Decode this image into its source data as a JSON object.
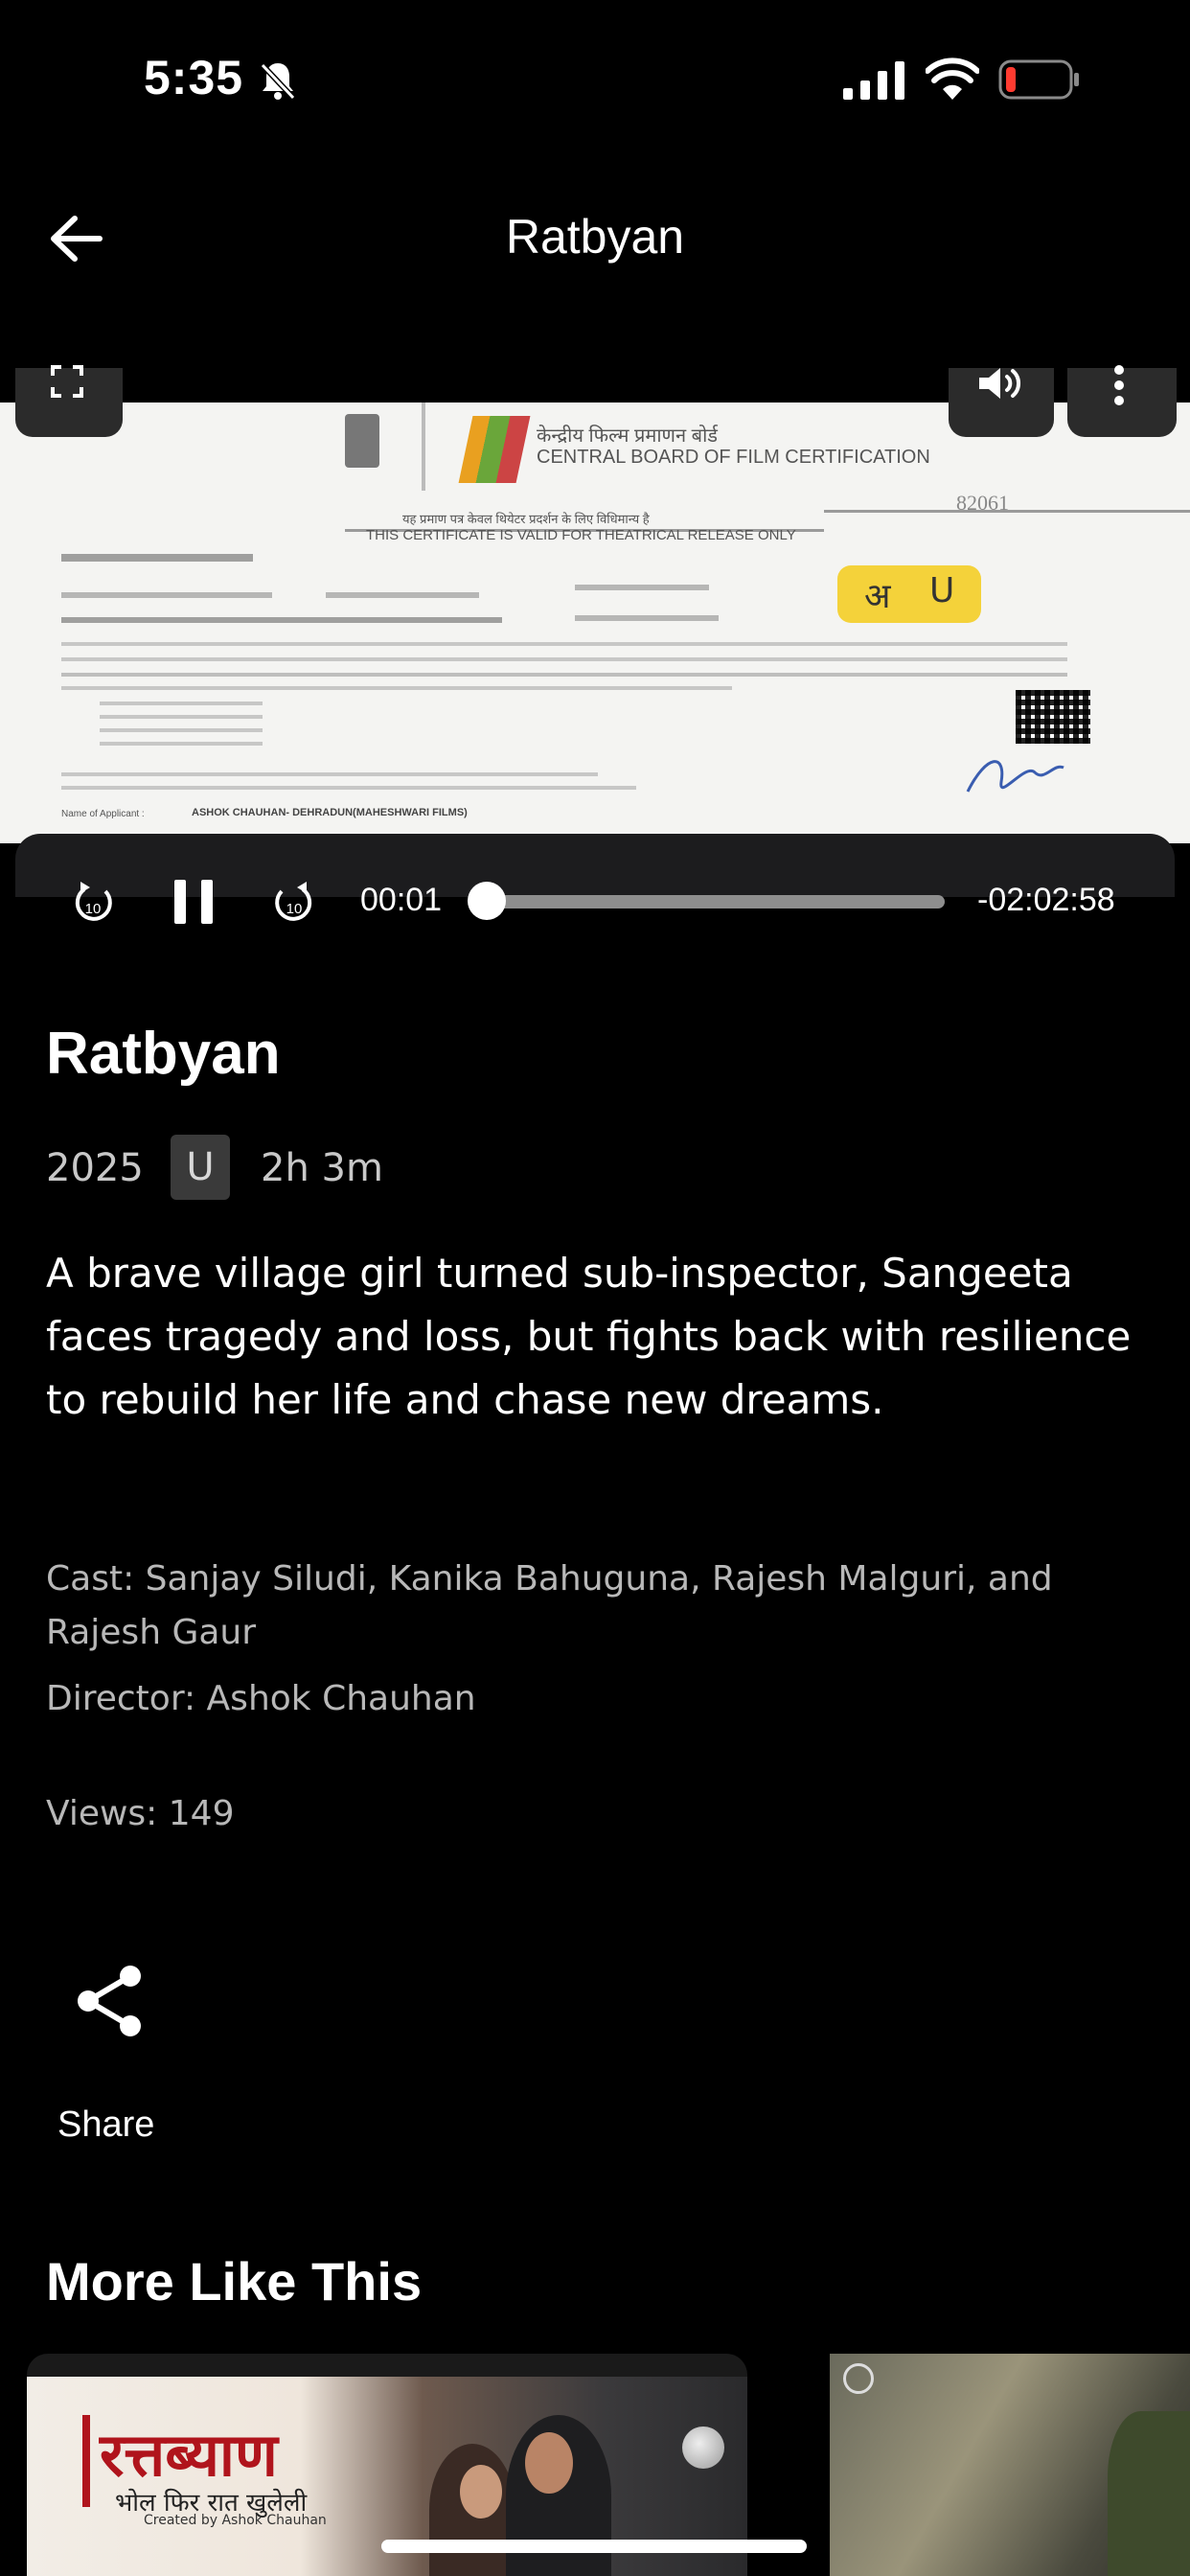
{
  "status_bar": {
    "time": "5:35",
    "battery_color": "#ff3b30"
  },
  "header": {
    "title": "Ratbyan",
    "back_icon": "arrow-left-icon"
  },
  "player": {
    "current_time": "00:01",
    "remaining_time": "-02:02:58",
    "progress": 0.0001,
    "rewind_seconds": "10",
    "forward_seconds": "10",
    "state": "playing",
    "certificate": {
      "hindi_board": "केन्द्रीय फिल्म प्रमाणन बोर्ड",
      "board": "CENTRAL BOARD OF FILM CERTIFICATION",
      "number": "82061",
      "valid_line_hi": "यह प्रमाण पत्र केवल थियेटर प्रदर्शन के लिए विधिमान्य है",
      "valid_line": "THIS CERTIFICATE IS VALID FOR THEATRICAL RELEASE ONLY",
      "rating_hi": "अ",
      "rating": "U",
      "applicant_label": "Name of Applicant :",
      "applicant": "ASHOK CHAUHAN- DEHRADUN(MAHESHWARI FILMS)"
    }
  },
  "movie": {
    "title": "Ratbyan",
    "year": "2025",
    "rating": "U",
    "duration": "2h 3m",
    "synopsis": "A brave village girl turned sub-inspector, Sangeeta faces tragedy and loss, but fights back with resilience to rebuild her life and chase new dreams.",
    "cast": "Cast: Sanjay Siludi, Kanika Bahuguna, Rajesh Malguri, and Rajesh Gaur",
    "director": "Director: Ashok Chauhan",
    "views": "Views: 149"
  },
  "actions": {
    "share_label": "Share"
  },
  "more_like_this": {
    "title": "More Like This",
    "items": [
      {
        "poster_title": "रत्तब्याण",
        "poster_subtitle": "भोल फिर रात खुलेली",
        "poster_credit": "Created by Ashok Chauhan"
      },
      {}
    ]
  }
}
